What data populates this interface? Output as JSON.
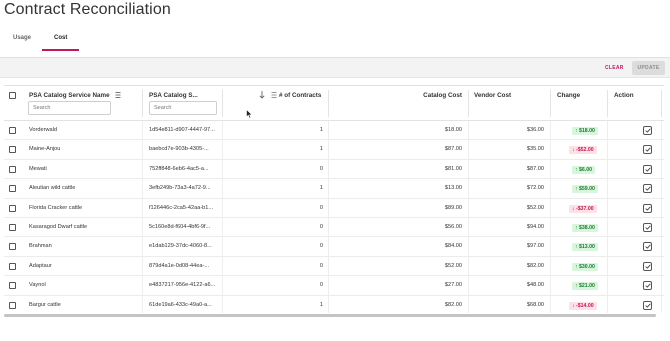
{
  "page": {
    "title": "Contract Reconciliation"
  },
  "tabs": [
    {
      "label": "Usage"
    },
    {
      "label": "Cost"
    }
  ],
  "toolbar": {
    "clear_label": "CLEAR",
    "update_label": "UPDATE"
  },
  "columns": {
    "service_name": {
      "label": "PSA Catalog Service Name",
      "filter_placeholder": "Search"
    },
    "service_id": {
      "label": "PSA Catalog S...",
      "filter_placeholder": "Search"
    },
    "contracts": {
      "label": "# of Contracts"
    },
    "catalog_cost": {
      "label": "Catalog Cost"
    },
    "vendor_cost": {
      "label": "Vendor Cost"
    },
    "change": {
      "label": "Change"
    },
    "action": {
      "label": "Action"
    }
  },
  "colors": {
    "accent": "#c2185b",
    "positive_bg": "#d9f5dd",
    "positive_fg": "#1e7d33",
    "negative_bg": "#fde1e4",
    "negative_fg": "#c2185b"
  },
  "icons": {
    "sort": "sort-arrow-icon",
    "action": "check-square-icon",
    "up": "arrow-up-icon",
    "down": "arrow-down-icon"
  },
  "rows": [
    {
      "name": "Vorderwald",
      "id": "1d54e811-d907-4447-97...",
      "contracts": "1",
      "catalog": "$18.00",
      "vendor": "$36.00",
      "change": "↑ $18.00",
      "dir": "pos"
    },
    {
      "name": "Maine-Anjou",
      "id": "baebcd7e-903b-4305-...",
      "contracts": "1",
      "catalog": "$87.00",
      "vendor": "$35.00",
      "change": "↓ -$52.00",
      "dir": "neg"
    },
    {
      "name": "Mewati",
      "id": "752ff848-6eb6-4ac5-a...",
      "contracts": "0",
      "catalog": "$81.00",
      "vendor": "$87.00",
      "change": "↑ $6.00",
      "dir": "pos"
    },
    {
      "name": "Aleutian wild cattle",
      "id": "3efb249b-73a3-4a72-9...",
      "contracts": "1",
      "catalog": "$13.00",
      "vendor": "$72.00",
      "change": "↑ $59.00",
      "dir": "pos"
    },
    {
      "name": "Florida Cracker cattle",
      "id": "f126446c-2ca5-42aa-b1...",
      "contracts": "0",
      "catalog": "$89.00",
      "vendor": "$52.00",
      "change": "↓ -$37.00",
      "dir": "neg"
    },
    {
      "name": "Kasaragod Dwarf cattle",
      "id": "5c160e8d-f604-4bf6-9f...",
      "contracts": "0",
      "catalog": "$56.00",
      "vendor": "$94.00",
      "change": "↑ $38.00",
      "dir": "pos"
    },
    {
      "name": "Brahman",
      "id": "e1dab129-37dc-4060-8...",
      "contracts": "0",
      "catalog": "$84.00",
      "vendor": "$97.00",
      "change": "↑ $13.00",
      "dir": "pos"
    },
    {
      "name": "Adaptaur",
      "id": "879d4a1e-0d08-44ea-...",
      "contracts": "0",
      "catalog": "$52.00",
      "vendor": "$82.00",
      "change": "↑ $30.00",
      "dir": "pos"
    },
    {
      "name": "Vaynol",
      "id": "e4837217-956e-4122-a6...",
      "contracts": "0",
      "catalog": "$27.00",
      "vendor": "$48.00",
      "change": "↑ $21.00",
      "dir": "pos"
    },
    {
      "name": "Bargur cattle",
      "id": "61de19a6-433c-49a0-a...",
      "contracts": "1",
      "catalog": "$82.00",
      "vendor": "$68.00",
      "change": "↓ -$14.00",
      "dir": "neg"
    }
  ]
}
